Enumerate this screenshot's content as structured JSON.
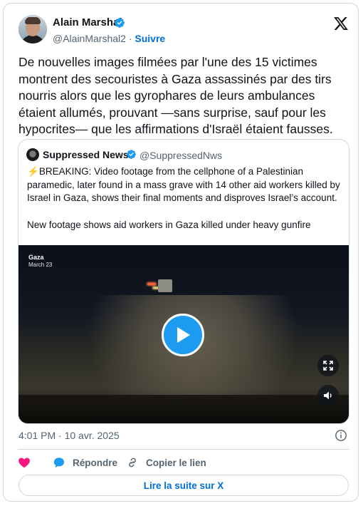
{
  "author": {
    "name": "Alain Marshal",
    "handle": "@AlainMarshal2",
    "separator": "·",
    "follow_label": "Suivre",
    "verified": true,
    "avatar_icon": "profile-photo"
  },
  "tweet": {
    "text": "De nouvelles images filmées par l'une des 15 victimes montrent des secouristes à Gaza assassinés par des tirs nourris alors que les gyrophares de leurs ambulances étaient allumés, prouvant —sans surprise, sauf pour les hypocrites— que les affirmations d'Israël étaient fausses.",
    "timestamp": "4:01 PM · 10 avr. 2025"
  },
  "quote": {
    "name": "Suppressed News.",
    "handle": "@SuppressedNws",
    "verified": true,
    "bolt": "⚡",
    "text": "BREAKING: Video footage from the cellphone of a Palestinian paramedic, later found in a mass grave with 14 other aid workers killed by Israel in Gaza, shows their final moments and disproves Israel’s account.",
    "text2": "New footage shows aid workers in Gaza killed under heavy gunfire",
    "video": {
      "location": "Gaza",
      "date": "March 23"
    }
  },
  "actions": {
    "like_icon": "heart-icon",
    "reply_label": "Répondre",
    "copy_label": "Copier le lien"
  },
  "read_more_label": "Lire la suite sur X",
  "colors": {
    "accent": "#1d9bf0",
    "link": "#006fd6",
    "like": "#f91880",
    "muted": "#536471",
    "border": "#cfd9de"
  }
}
